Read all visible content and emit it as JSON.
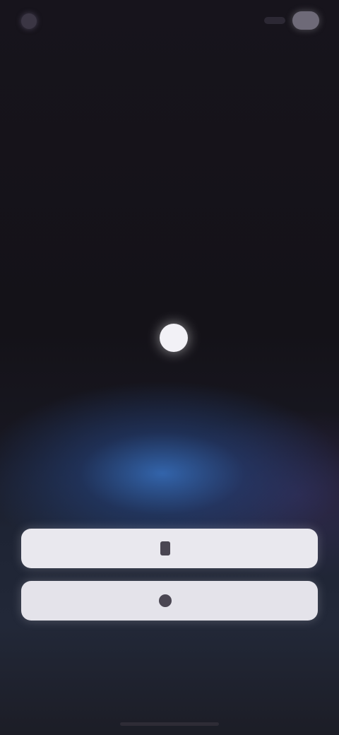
{
  "status_bar": {
    "time": "",
    "signal_icon": "signal-icon",
    "battery_icon": "battery-icon"
  },
  "logo": {
    "wordmark": "",
    "mark_icon": "logo-circle-icon"
  },
  "actions": {
    "primary_label": "",
    "primary_icon": "phone-icon",
    "secondary_label": "",
    "secondary_icon": "account-icon",
    "alt_link_label": ""
  },
  "footer": {
    "link_1": "",
    "link_2": ""
  },
  "colors": {
    "background": "#141218",
    "glow_blue": "#3468b2",
    "button_fill": "#e9e8ee",
    "button_text": "#1d1b22"
  }
}
